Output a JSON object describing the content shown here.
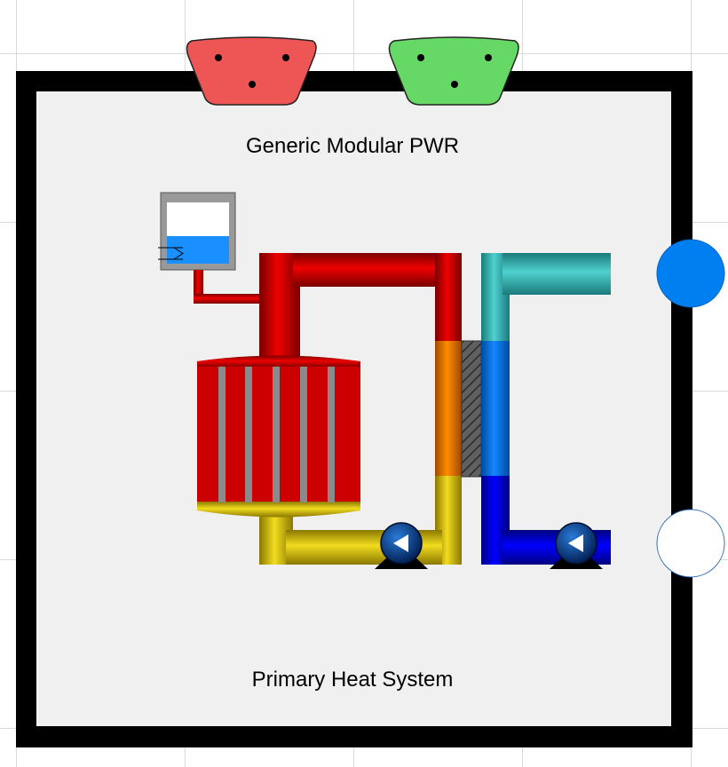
{
  "title": "Generic Modular PWR",
  "subtitle": "Primary Heat System",
  "connectors": {
    "left_plug": {
      "color": "#ee5555"
    },
    "right_plug": {
      "color": "#66d866"
    },
    "outlet_port": {
      "color": "#0080f0"
    },
    "inlet_port": {
      "color": "#ffffff"
    }
  },
  "colors": {
    "frame": "#000000",
    "panel": "#f0f0f0",
    "hot_leg": "#dd0000",
    "cold_leg": "#e6cf10",
    "transition": "#f08000",
    "secondary_hot": "#40c8c8",
    "secondary_mid": "#0a78f0",
    "secondary_cold": "#0000ee",
    "pump": "#003c8c",
    "tank_water": "#1a8fff"
  },
  "pressurizer": {
    "level": 0.45
  }
}
